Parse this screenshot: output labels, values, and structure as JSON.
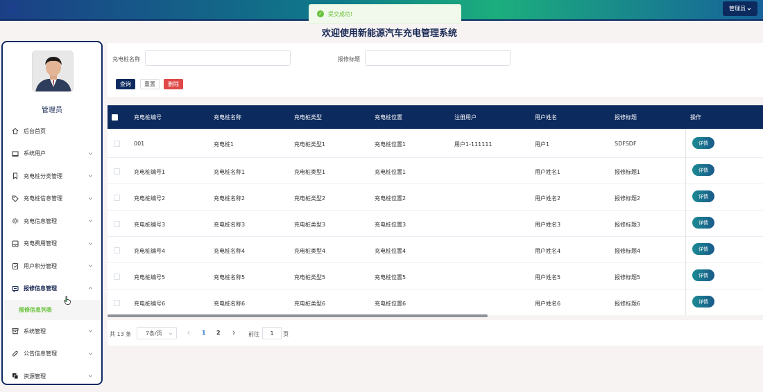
{
  "header": {
    "admin_label": "管理员",
    "toast": "提交成功!"
  },
  "page_title": "欢迎使用新能源汽车充电管理系统",
  "sidebar": {
    "role": "管理员",
    "items": [
      {
        "label": "后台首页",
        "icon": "home-icon"
      },
      {
        "label": "系统用户",
        "icon": "monitor-icon"
      },
      {
        "label": "充电桩分类管理",
        "icon": "bookmark-icon"
      },
      {
        "label": "充电桩信息管理",
        "icon": "tag-icon"
      },
      {
        "label": "充电信息管理",
        "icon": "sun-icon"
      },
      {
        "label": "充电费用管理",
        "icon": "inbox-icon"
      },
      {
        "label": "用户积分管理",
        "icon": "clipboard-check-icon"
      },
      {
        "label": "报修信息管理",
        "icon": "message-icon"
      },
      {
        "label": "系统管理",
        "icon": "archive-icon"
      },
      {
        "label": "公告信息管理",
        "icon": "paperclip-icon"
      },
      {
        "label": "资源管理",
        "icon": "copy-icon"
      }
    ],
    "submenu_label": "报修信息列表"
  },
  "search": {
    "name_label": "充电桩名称",
    "title_label": "报修标题",
    "query": "查询",
    "reset": "重置",
    "delete": "删除"
  },
  "table": {
    "headers": [
      "充电桩编号",
      "充电桩名称",
      "充电桩类型",
      "充电桩位置",
      "注册用户",
      "用户姓名",
      "报修标题",
      "操作"
    ],
    "detail_label": "详情",
    "rows": [
      [
        "001",
        "充电桩1",
        "充电桩类型1",
        "充电桩位置1",
        "用户1-111111",
        "用户1",
        "SDFSDF"
      ],
      [
        "充电桩编号1",
        "充电桩名称1",
        "充电桩类型1",
        "充电桩位置1",
        "",
        "用户姓名1",
        "报修标题1"
      ],
      [
        "充电桩编号2",
        "充电桩名称2",
        "充电桩类型2",
        "充电桩位置2",
        "",
        "用户姓名2",
        "报修标题2"
      ],
      [
        "充电桩编号3",
        "充电桩名称3",
        "充电桩类型3",
        "充电桩位置3",
        "",
        "用户姓名3",
        "报修标题3"
      ],
      [
        "充电桩编号4",
        "充电桩名称4",
        "充电桩类型4",
        "充电桩位置4",
        "",
        "用户姓名4",
        "报修标题4"
      ],
      [
        "充电桩编号5",
        "充电桩名称5",
        "充电桩类型5",
        "充电桩位置5",
        "",
        "用户姓名5",
        "报修标题5"
      ],
      [
        "充电桩编号6",
        "充电桩名称6",
        "充电桩类型6",
        "充电桩位置6",
        "",
        "用户姓名6",
        "报修标题6"
      ]
    ]
  },
  "pagination": {
    "total": "共 13 条",
    "page_size": "7条/页",
    "pages": [
      "1",
      "2"
    ],
    "current": "1",
    "goto_prefix": "前往",
    "goto_value": "1",
    "goto_suffix": "页"
  },
  "colors": {
    "primary": "#0c2a5e",
    "success": "#67c23a",
    "danger": "#e04848"
  }
}
